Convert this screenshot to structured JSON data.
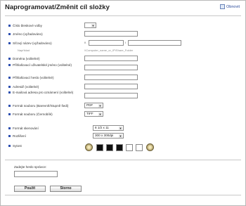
{
  "header": {
    "title": "Naprogramovat/Změnit cíl složky",
    "refresh_label": "Obnovit"
  },
  "fields": {
    "speed_dial": {
      "label": "Číslo bleskové volby",
      "value": ""
    },
    "name": {
      "label": "Jméno (vyžadováno)",
      "value": ""
    },
    "network_path": {
      "label": "Síťový název (vyžadováno)",
      "prefix": "\\\\",
      "separator": "\\",
      "value_host": "",
      "value_folder": ""
    },
    "example": {
      "label": "Například",
      "text": "\\\\Computer_name_or_IP\\Share_Folder"
    },
    "domain": {
      "label": "Doména (volitelné)",
      "value": ""
    },
    "user": {
      "label": "Přihlašovací uživatelské jméno (volitelné)",
      "value": ""
    },
    "password": {
      "label": "Přihlašovací heslo (volitelné)",
      "value": ""
    },
    "subfolder": {
      "label": "Adresář (volitelné)",
      "value": ""
    },
    "email": {
      "label": "E-mailová adresa pro oznámení (volitelné)",
      "value": ""
    },
    "format_color": {
      "label": "Formát souboru (Barevně/Stupně šedi)",
      "value": "PDF"
    },
    "format_bw": {
      "label": "Formát souboru (Černobílé)",
      "value": "TIFF"
    },
    "scan_size": {
      "label": "Formát skenování",
      "value": "8 1/2 x 11"
    },
    "resolution": {
      "label": "Rozlišení",
      "value": "300 x 300dpi"
    },
    "density": {
      "label": "Sytost",
      "levels": 5,
      "selected": 1
    }
  },
  "admin": {
    "label": "Zadejte heslo správce:",
    "value": ""
  },
  "buttons": {
    "apply": "Použít",
    "cancel": "Storno"
  },
  "colors": {
    "bullet": "#2d4fb0",
    "frame": "#b8b8b8"
  }
}
